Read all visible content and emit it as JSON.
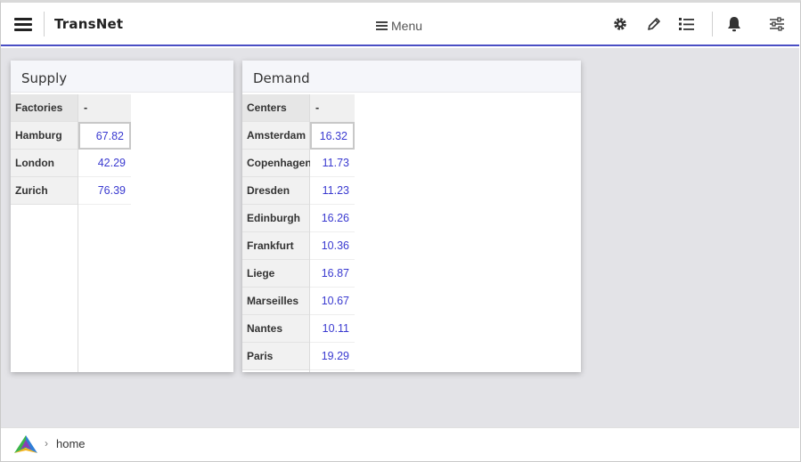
{
  "header": {
    "app_title": "TransNet",
    "menu_label": "Menu"
  },
  "supply": {
    "title": "Supply",
    "label_header": "Factories",
    "value_header": "-",
    "rows": [
      {
        "label": "Hamburg",
        "value": "67.82"
      },
      {
        "label": "London",
        "value": "42.29"
      },
      {
        "label": "Zurich",
        "value": "76.39"
      }
    ]
  },
  "demand": {
    "title": "Demand",
    "label_header": "Centers",
    "value_header": "-",
    "rows": [
      {
        "label": "Amsterdam",
        "value": "16.32"
      },
      {
        "label": "Copenhagen",
        "value": "11.73"
      },
      {
        "label": "Dresden",
        "value": "11.23"
      },
      {
        "label": "Edinburgh",
        "value": "16.26"
      },
      {
        "label": "Frankfurt",
        "value": "10.36"
      },
      {
        "label": "Liege",
        "value": "16.87"
      },
      {
        "label": "Marseilles",
        "value": "10.67"
      },
      {
        "label": "Nantes",
        "value": "10.11"
      },
      {
        "label": "Paris",
        "value": "19.29"
      }
    ]
  },
  "footer": {
    "breadcrumb": "home"
  },
  "colors": {
    "accent": "#4a4fc4",
    "value_text": "#3a3ad0"
  },
  "icons": [
    "hamburger-icon",
    "gear-icon",
    "pencil-icon",
    "list-icon",
    "bell-icon",
    "sliders-icon",
    "logo-icon"
  ]
}
